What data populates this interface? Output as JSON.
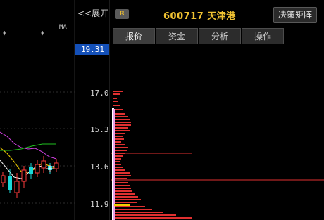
{
  "chart_panel": {
    "collapse_label": "<<展开",
    "ma_label": "MA",
    "stars": [
      "*",
      "*"
    ],
    "current_price": "19.31",
    "price_ticks": [
      "17.0",
      "15.3",
      "13.6",
      "11.9"
    ],
    "colors": {
      "up": "#ff3b3b",
      "down": "#19d7d7",
      "ma5": "#f5f5f5",
      "ma10": "#f0d000",
      "ma20": "#d040e0",
      "ma60": "#20c020"
    }
  },
  "header": {
    "badge": "R",
    "stock_title": "600717 天津港",
    "decision_button": "决策矩阵"
  },
  "tabs": [
    {
      "label": "报价",
      "active": true
    },
    {
      "label": "资金",
      "active": false
    },
    {
      "label": "分析",
      "active": false
    },
    {
      "label": "操作",
      "active": false
    }
  ],
  "chip_distribution": {
    "colors": {
      "profit": "#e03030",
      "current": "#f0d000",
      "cost": "#ffffff",
      "avg_line": "#e9a0e9"
    }
  }
}
